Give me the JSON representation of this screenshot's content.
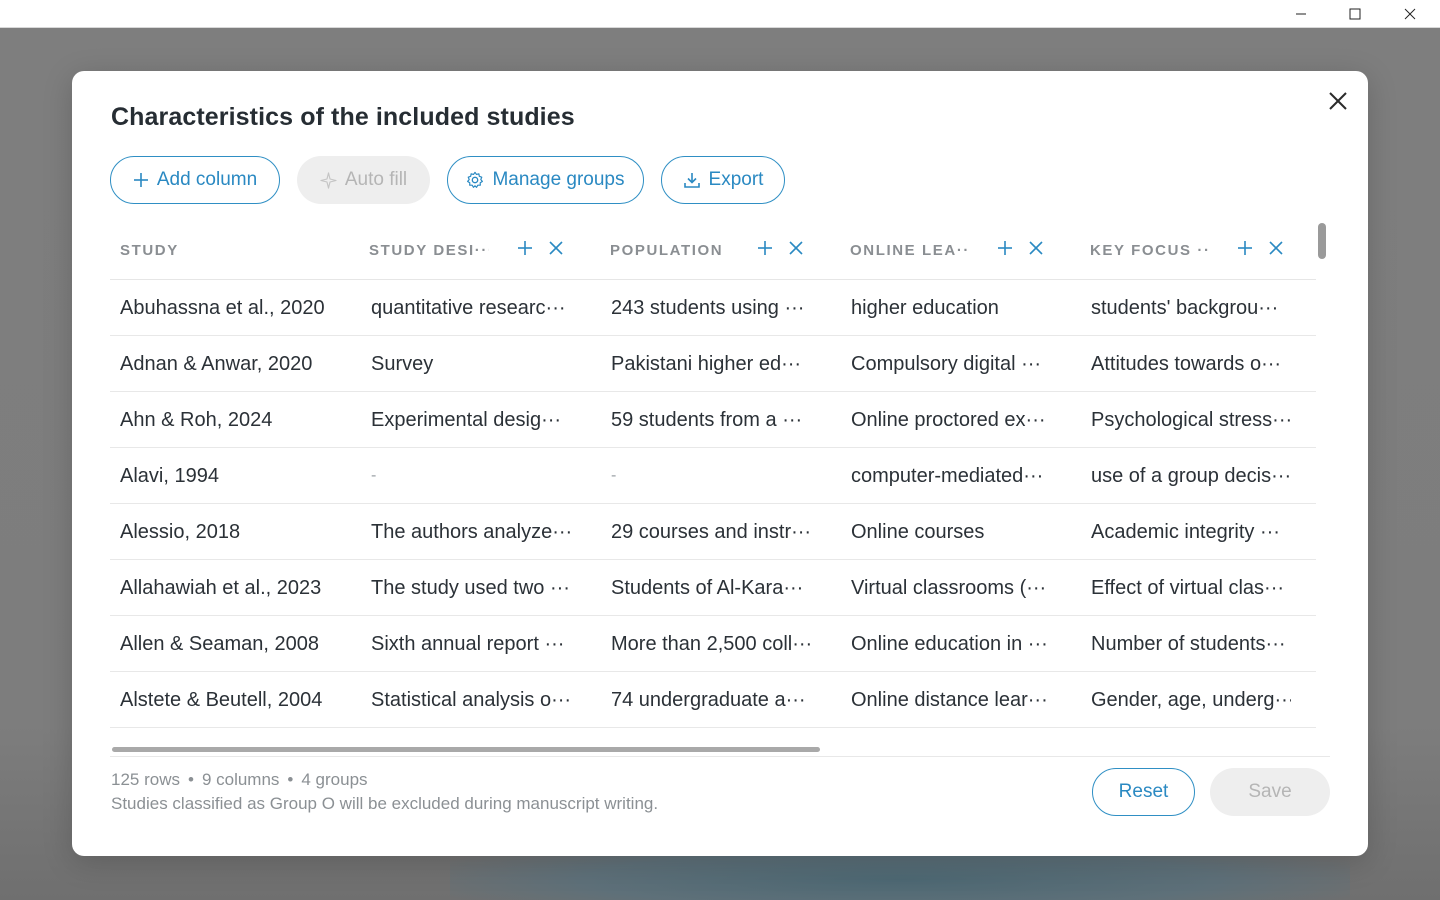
{
  "window": {
    "controls": [
      "minimize-icon",
      "maximize-icon",
      "close-icon"
    ]
  },
  "modal": {
    "title": "Characteristics of the included studies",
    "close_icon": "close-icon"
  },
  "toolbar": {
    "add_column": "Add column",
    "auto_fill": "Auto fill",
    "manage_groups": "Manage groups",
    "export": "Export"
  },
  "table": {
    "columns": [
      "STUDY",
      "STUDY DESI···",
      "POPULATION",
      "ONLINE LEA···",
      "KEY FOCUS ···"
    ],
    "rows": [
      [
        "Abuhassna et al., 2020",
        "quantitative researc···",
        "243 students using ···",
        "higher education",
        "students' backgrou···"
      ],
      [
        "Adnan & Anwar, 2020",
        "Survey",
        "Pakistani higher ed···",
        "Compulsory digital ···",
        "Attitudes towards o···"
      ],
      [
        "Ahn & Roh, 2024",
        "Experimental desig···",
        "59 students from a ···",
        "Online proctored ex···",
        "Psychological stress···"
      ],
      [
        "Alavi, 1994",
        "-",
        "-",
        "computer-mediated···",
        "use of a group decis···"
      ],
      [
        "Alessio, 2018",
        "The authors analyze···",
        "29 courses and instr···",
        "Online courses",
        "Academic integrity ···"
      ],
      [
        "Allahawiah et al., 2023",
        "The study used two ···",
        "Students of Al-Kara···",
        "Virtual classrooms (···",
        "Effect of virtual clas···"
      ],
      [
        "Allen & Seaman, 2008",
        "Sixth annual report ···",
        "More than 2,500 coll···",
        "Online education in ···",
        "Number of students···"
      ],
      [
        "Alstete & Beutell, 2004",
        "Statistical analysis o···",
        "74 undergraduate a···",
        "Online distance lear···",
        "Gender, age, underg···"
      ]
    ]
  },
  "footer": {
    "rows": "125 rows",
    "columns": "9 columns",
    "groups": "4 groups",
    "separator": "•",
    "note": "Studies classified as Group O will be excluded during manuscript writing.",
    "reset": "Reset",
    "save": "Save"
  },
  "colors": {
    "accent": "#2a89c2",
    "disabled_bg": "#eeeeee",
    "disabled_text": "#b5b5b5",
    "header_text": "#8a8e92",
    "body_text": "#2b3137"
  }
}
